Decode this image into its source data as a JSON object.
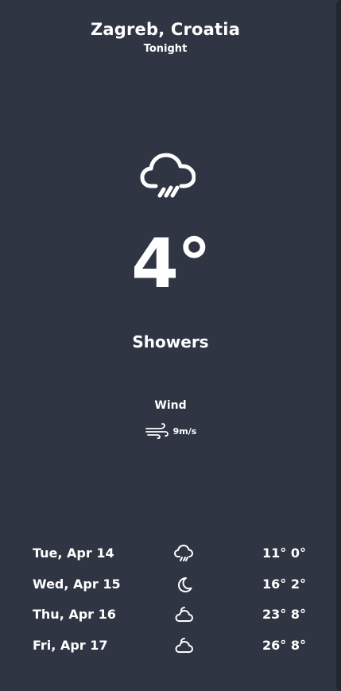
{
  "header": {
    "city": "Zagreb, Croatia",
    "period": "Tonight"
  },
  "current": {
    "icon": "cloud-rain-icon",
    "temperature": "4°",
    "condition": "Showers"
  },
  "wind": {
    "title": "Wind",
    "icon": "wind-icon",
    "speed": "9m/s"
  },
  "forecast": [
    {
      "day": "Tue, Apr 14",
      "icon": "cloud-rain-icon",
      "temps": "11° 0°"
    },
    {
      "day": "Wed, Apr 15",
      "icon": "moon-icon",
      "temps": "16° 2°"
    },
    {
      "day": "Thu, Apr 16",
      "icon": "partly-cloudy-icon",
      "temps": "23° 8°"
    },
    {
      "day": "Fri, Apr 17",
      "icon": "partly-cloudy-icon",
      "temps": "26° 8°"
    }
  ],
  "colors": {
    "background": "#2f3542",
    "text": "#ffffff"
  }
}
